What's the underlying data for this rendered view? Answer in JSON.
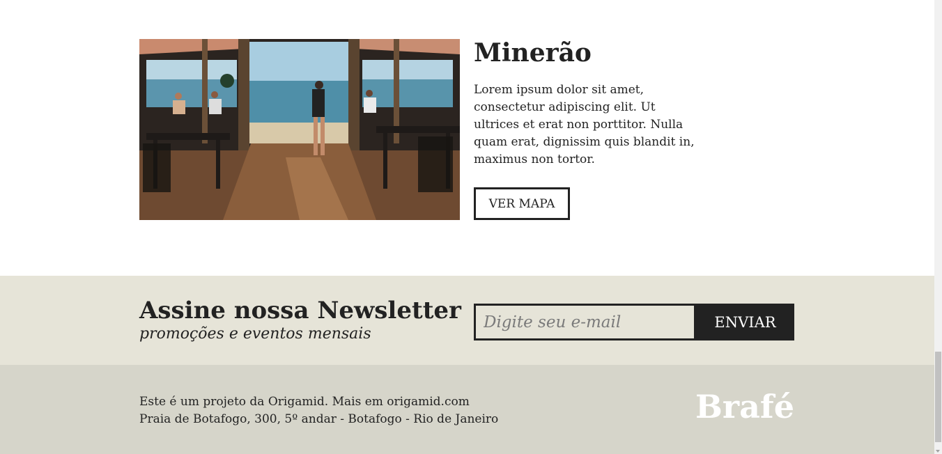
{
  "store": {
    "name": "Minerão",
    "description": "Lorem ipsum dolor sit amet, consectetur adipiscing elit. Ut ultrices et erat non porttitor. Nulla quam erat, dignissim quis blandit in, maximus non tortor.",
    "map_button_label": "VER MAPA"
  },
  "newsletter": {
    "title": "Assine nossa Newsletter",
    "subtitle": "promoções e eventos mensais",
    "email_placeholder": "Digite seu e-mail",
    "email_value": "",
    "submit_label": "ENVIAR"
  },
  "footer": {
    "line1": "Este é um projeto da Origamid. Mais em origamid.com",
    "line2": "Praia de Botafogo, 300, 5º andar - Botafogo - Rio de Janeiro",
    "logo": "Brafé"
  },
  "colors": {
    "newsletter_bg": "#e6e4d8",
    "footer_bg": "#d6d5ca",
    "text": "#222222",
    "button_dark": "#222222"
  },
  "icons": [
    "store-photo-image",
    "scrollbar-down-arrow-icon"
  ]
}
